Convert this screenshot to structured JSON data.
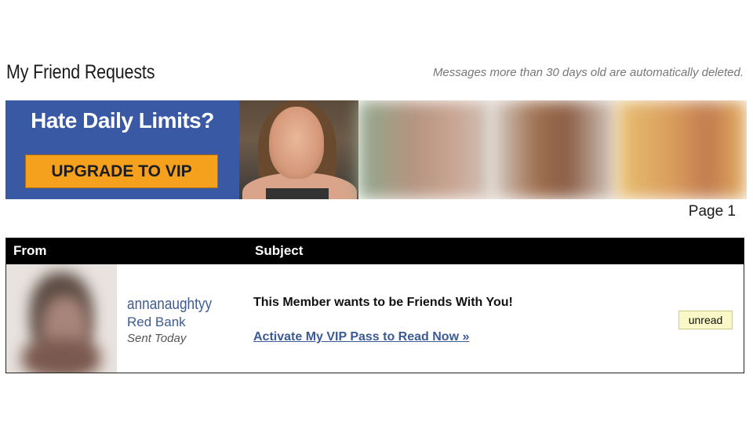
{
  "header": {
    "title": "My Friend Requests",
    "notice": "Messages more than 30 days old are automatically deleted."
  },
  "banner": {
    "headline": "Hate Daily Limits?",
    "cta_label": "UPGRADE TO VIP",
    "colors": {
      "background": "#3a59a4",
      "button": "#f5a11e"
    }
  },
  "pagination": {
    "label": "Page 1"
  },
  "table": {
    "columns": [
      "From",
      "Subject"
    ],
    "rows": [
      {
        "username": "annanaughtyy",
        "location": "Red Bank",
        "sent": "Sent Today",
        "subject": "This Member wants to be Friends With You!",
        "action_link": "Activate My VIP Pass to Read Now »",
        "status": "unread"
      }
    ]
  }
}
